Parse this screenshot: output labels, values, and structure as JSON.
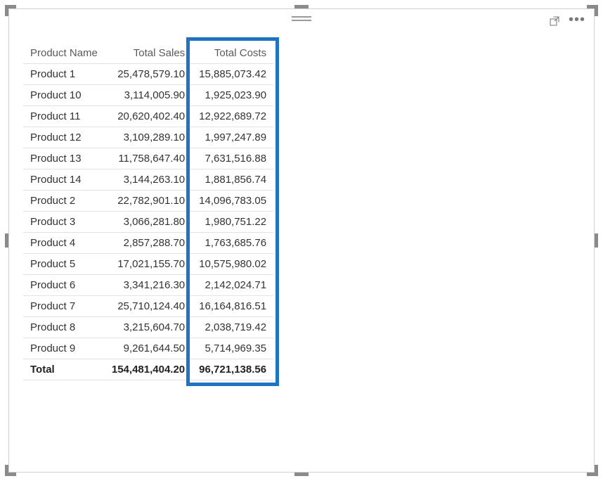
{
  "table": {
    "columns": [
      {
        "key": "product",
        "label": "Product Name",
        "type": "text"
      },
      {
        "key": "sales",
        "label": "Total Sales",
        "type": "num"
      },
      {
        "key": "costs",
        "label": "Total Costs",
        "type": "num"
      }
    ],
    "rows": [
      {
        "product": "Product 1",
        "sales": "25,478,579.10",
        "costs": "15,885,073.42"
      },
      {
        "product": "Product 10",
        "sales": "3,114,005.90",
        "costs": "1,925,023.90"
      },
      {
        "product": "Product 11",
        "sales": "20,620,402.40",
        "costs": "12,922,689.72"
      },
      {
        "product": "Product 12",
        "sales": "3,109,289.10",
        "costs": "1,997,247.89"
      },
      {
        "product": "Product 13",
        "sales": "11,758,647.40",
        "costs": "7,631,516.88"
      },
      {
        "product": "Product 14",
        "sales": "3,144,263.10",
        "costs": "1,881,856.74"
      },
      {
        "product": "Product 2",
        "sales": "22,782,901.10",
        "costs": "14,096,783.05"
      },
      {
        "product": "Product 3",
        "sales": "3,066,281.80",
        "costs": "1,980,751.22"
      },
      {
        "product": "Product 4",
        "sales": "2,857,288.70",
        "costs": "1,763,685.76"
      },
      {
        "product": "Product 5",
        "sales": "17,021,155.70",
        "costs": "10,575,980.02"
      },
      {
        "product": "Product 6",
        "sales": "3,341,216.30",
        "costs": "2,142,024.71"
      },
      {
        "product": "Product 7",
        "sales": "25,710,124.40",
        "costs": "16,164,816.51"
      },
      {
        "product": "Product 8",
        "sales": "3,215,604.70",
        "costs": "2,038,719.42"
      },
      {
        "product": "Product 9",
        "sales": "9,261,644.50",
        "costs": "5,714,969.35"
      }
    ],
    "total": {
      "product": "Total",
      "sales": "154,481,404.20",
      "costs": "96,721,138.56"
    }
  },
  "highlight": {
    "column_key": "costs",
    "color": "#1f74c2"
  }
}
